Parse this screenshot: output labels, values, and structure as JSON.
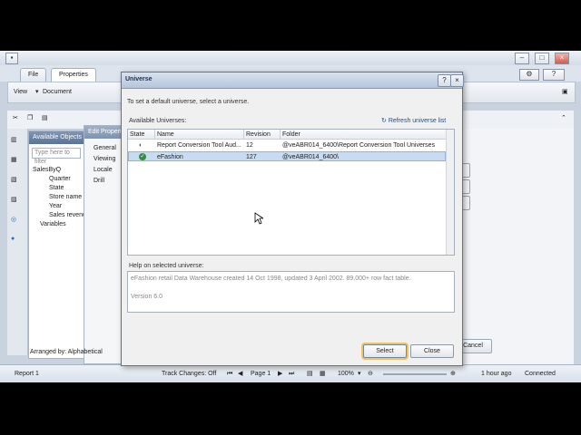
{
  "app": {
    "tabs": [
      "File",
      "Properties"
    ],
    "toolbar": {
      "view_label": "View",
      "document_label": "Document"
    },
    "left_panel": {
      "header": "Available Objects",
      "search_placeholder": "Type here to filter",
      "tree": [
        "SalesByQ",
        "Quarter",
        "State",
        "Store name",
        "Year",
        "Sales revenue",
        "Variables"
      ]
    },
    "props_panel": {
      "header": "Edit Properties",
      "items": [
        "General",
        "Viewing",
        "Locale",
        "Drill"
      ]
    },
    "arranged_by": "Arranged by: Alphabetical",
    "cancel_label": "Cancel",
    "status": {
      "report": "Report 1",
      "track_changes": "Track Changes: Off",
      "page": "Page 1",
      "zoom": "100%",
      "time": "1 hour ago",
      "connection": "Connected"
    }
  },
  "dialog": {
    "title": "Universe",
    "instruction": "To set a default universe, select a universe.",
    "available_label": "Available Universes:",
    "refresh_label": "Refresh universe list",
    "columns": [
      "State",
      "Name",
      "Revision",
      "Folder"
    ],
    "rows": [
      {
        "state": "loading",
        "name": "Report Conversion Tool Aud...",
        "revision": "12",
        "folder": "@veABR014_6400\\Report Conversion Tool Universes",
        "selected": false
      },
      {
        "state": "ok",
        "name": "eFashion",
        "revision": "127",
        "folder": "@veABR014_6400\\",
        "selected": true
      }
    ],
    "help_label": "Help on selected universe:",
    "help_lines": [
      "eFashion retail Data Warehouse created 14 Oct 1998, updated 3 April 2002. 89,000+ row fact table.",
      "",
      "Version 6.0"
    ],
    "select_label": "Select",
    "close_label": "Close",
    "help_icon": "?",
    "close_icon": "×"
  },
  "colors": {
    "accent": "#f1c15a",
    "selection": "#c7dcf2",
    "title": "#b5c5da"
  }
}
